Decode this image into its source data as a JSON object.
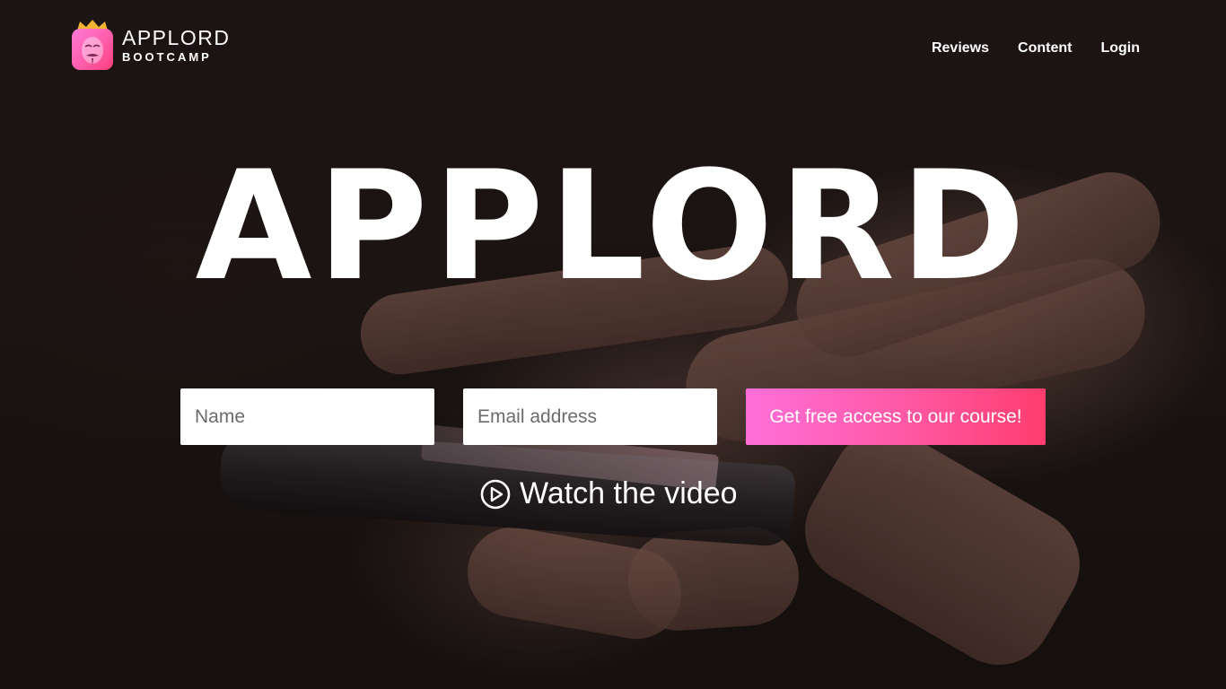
{
  "brand": {
    "title": "APPLORD",
    "subtitle": "BOOTCAMP",
    "accent": "#ff5aa6"
  },
  "nav": {
    "items": [
      {
        "label": "Reviews"
      },
      {
        "label": "Content"
      },
      {
        "label": "Login"
      }
    ]
  },
  "hero": {
    "title": "APPLORD"
  },
  "signup": {
    "name_placeholder": "Name",
    "email_placeholder": "Email address",
    "submit_label": "Get free access to our course!"
  },
  "video": {
    "label": "Watch the video",
    "icon": "play-circle-icon"
  }
}
